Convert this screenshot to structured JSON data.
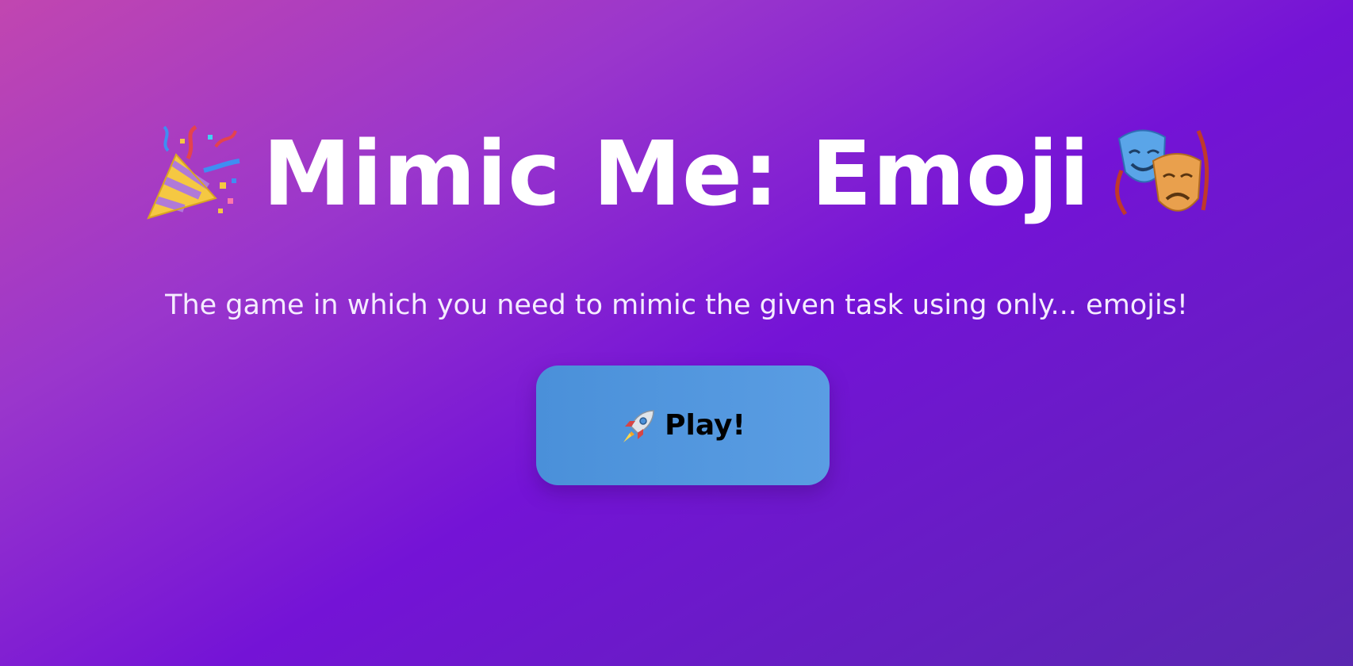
{
  "header": {
    "title": "Mimic Me: Emoji",
    "left_icon": "party-popper-icon",
    "right_icon": "performing-arts-icon"
  },
  "subtitle": "The game in which you need to mimic the given task using only... emojis!",
  "play_button": {
    "icon": "rocket-icon",
    "label": "Play!"
  },
  "colors": {
    "background_start": "#c146b0",
    "background_mid": "#7413d6",
    "background_end": "#5a27b0",
    "button": "#4a90d9",
    "title_text": "#ffffff",
    "button_text": "#000000"
  }
}
